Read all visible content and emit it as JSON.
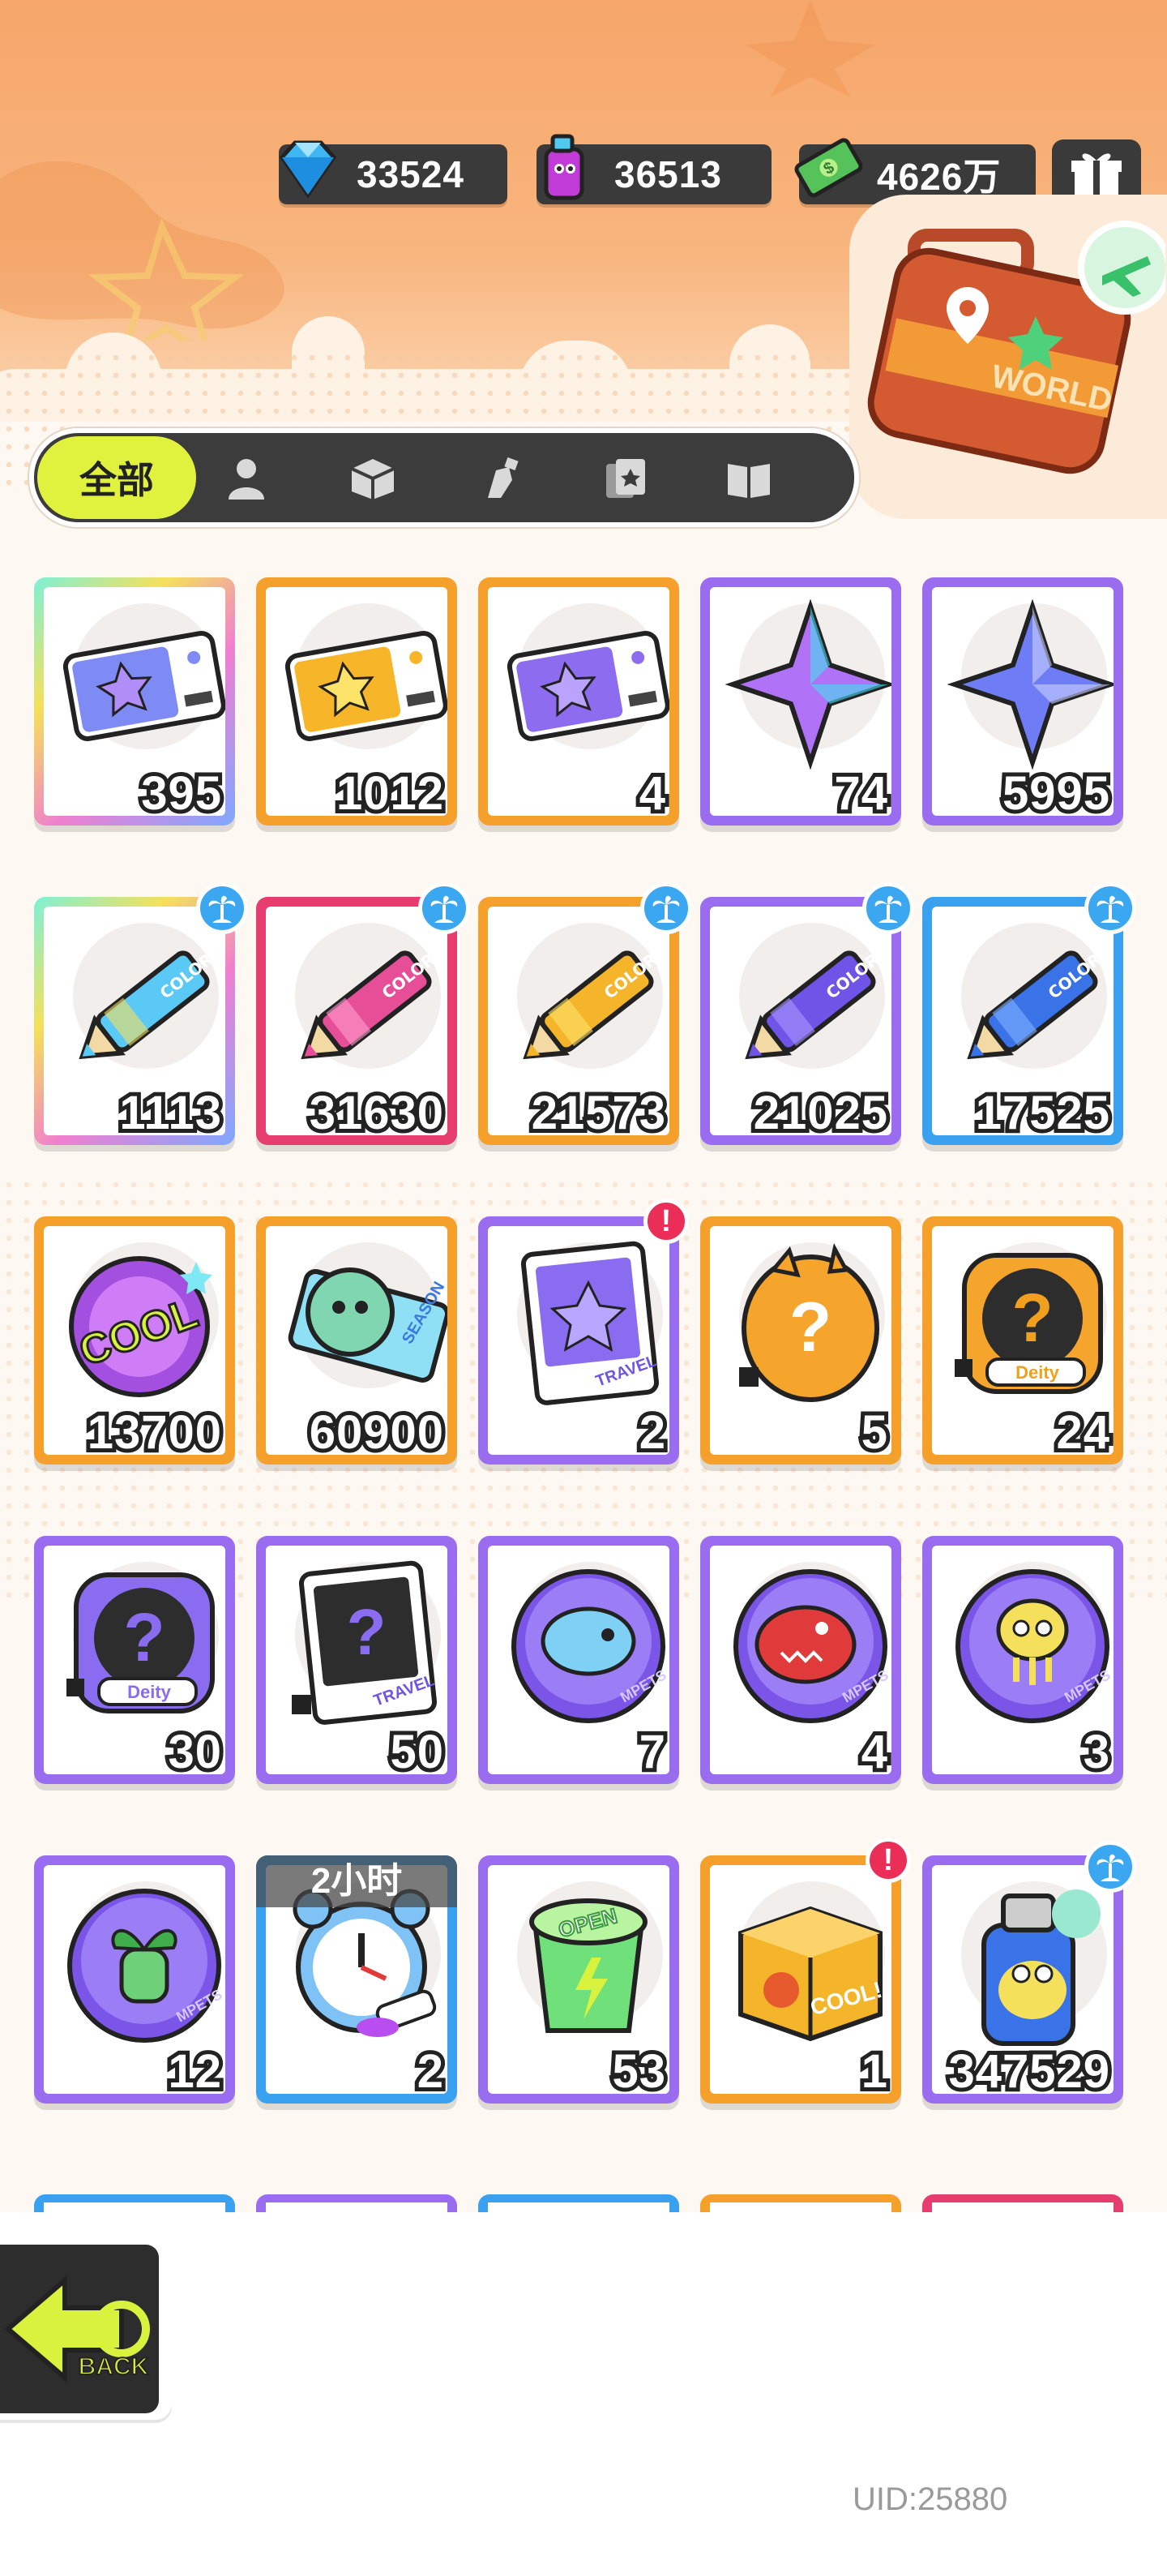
{
  "header": {
    "currencies": [
      {
        "name": "diamond",
        "value": "33524"
      },
      {
        "name": "spray-can",
        "value": "36513"
      },
      {
        "name": "cash",
        "value": "4626万"
      }
    ]
  },
  "world_badge_text": "WORLD",
  "tabs": {
    "active_label": "全部",
    "icons": [
      "person-icon",
      "box-icon",
      "spray-icon",
      "cards-icon",
      "book-icon"
    ]
  },
  "items": [
    {
      "count": "395",
      "border": "rainbow",
      "art": "ticket-purple",
      "badge": ""
    },
    {
      "count": "1012",
      "border": "#f5a02b",
      "art": "ticket-yellow",
      "badge": ""
    },
    {
      "count": "4",
      "border": "#f5a02b",
      "art": "ticket-violet",
      "badge": ""
    },
    {
      "count": "74",
      "border": "#9a6cf0",
      "art": "star-rainbow",
      "badge": ""
    },
    {
      "count": "5995",
      "border": "#9a6cf0",
      "art": "star-blue",
      "badge": ""
    },
    {
      "count": "1113",
      "border": "rainbow",
      "art": "crayon-rainbow",
      "badge": "palm"
    },
    {
      "count": "31630",
      "border": "#e63d6e",
      "art": "crayon-pink",
      "badge": "palm"
    },
    {
      "count": "21573",
      "border": "#f5a02b",
      "art": "crayon-yellow",
      "badge": "palm"
    },
    {
      "count": "21025",
      "border": "#9a6cf0",
      "art": "crayon-purple",
      "badge": "palm"
    },
    {
      "count": "17525",
      "border": "#3aa0f0",
      "art": "crayon-blue",
      "badge": "palm"
    },
    {
      "count": "13700",
      "border": "#f5a02b",
      "art": "cool-sticker",
      "badge": ""
    },
    {
      "count": "60900",
      "border": "#f5a02b",
      "art": "season-ticket",
      "badge": ""
    },
    {
      "count": "2",
      "border": "#9a6cf0",
      "art": "travel-card",
      "badge": "alert"
    },
    {
      "count": "5",
      "border": "#f5a02b",
      "art": "mystery-egg",
      "badge": ""
    },
    {
      "count": "24",
      "border": "#f5a02b",
      "art": "deity-mystery-gold",
      "badge": ""
    },
    {
      "count": "30",
      "border": "#9a6cf0",
      "art": "deity-mystery-purple",
      "badge": ""
    },
    {
      "count": "50",
      "border": "#9a6cf0",
      "art": "travel-mystery",
      "badge": ""
    },
    {
      "count": "7",
      "border": "#9a6cf0",
      "art": "pet-fish",
      "badge": ""
    },
    {
      "count": "4",
      "border": "#9a6cf0",
      "art": "pet-red-fish",
      "badge": ""
    },
    {
      "count": "3",
      "border": "#9a6cf0",
      "art": "pet-jelly",
      "badge": ""
    },
    {
      "count": "12",
      "border": "#9a6cf0",
      "art": "pet-sprout",
      "badge": ""
    },
    {
      "count": "2",
      "border": "#3aa0f0",
      "art": "alarm-clock",
      "badge": "",
      "timer": "2小时"
    },
    {
      "count": "53",
      "border": "#9a6cf0",
      "art": "open-cup",
      "badge": ""
    },
    {
      "count": "1",
      "border": "#f5a02b",
      "art": "cool-box",
      "badge": "alert"
    },
    {
      "count": "347529",
      "border": "#9a6cf0",
      "art": "spray-can-blue",
      "badge": "palm"
    }
  ],
  "back_label": "BACK",
  "uid": "UID:25880"
}
